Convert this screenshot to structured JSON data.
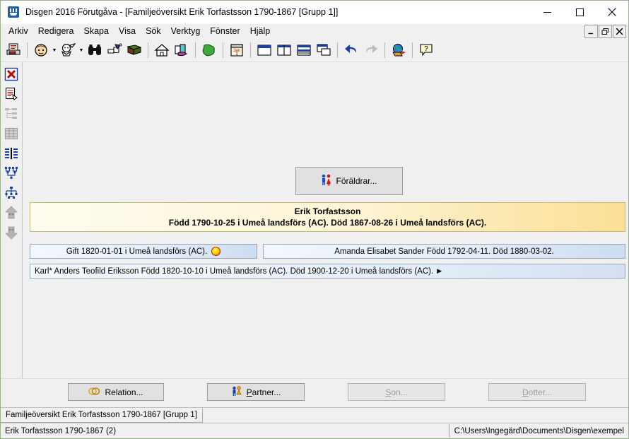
{
  "window": {
    "title": "Disgen 2016 Förutgåva - [Familjeöversikt Erik Torfastsson 1790-1867 [Grupp 1]]",
    "app_icon": "disgen-app-icon",
    "minimize": "minimize-icon",
    "maximize": "maximize-icon",
    "close": "close-icon"
  },
  "menubar": {
    "items": [
      {
        "label": "Arkiv"
      },
      {
        "label": "Redigera"
      },
      {
        "label": "Skapa"
      },
      {
        "label": "Visa"
      },
      {
        "label": "Sök"
      },
      {
        "label": "Verktyg"
      },
      {
        "label": "Fönster"
      },
      {
        "label": "Hjälp"
      }
    ],
    "mdi": {
      "minimize": "mdi-minimize-icon",
      "restore": "mdi-restore-icon",
      "close": "mdi-close-icon"
    }
  },
  "toolbar": {
    "buttons": [
      {
        "name": "print-icon"
      },
      {
        "name": "person-face-icon"
      },
      {
        "name": "person-search-icon"
      },
      {
        "name": "binoculars-icon"
      },
      {
        "name": "hand-pointer-icon"
      },
      {
        "name": "book-icon"
      },
      {
        "name": "home-icon"
      },
      {
        "name": "places-icon"
      },
      {
        "name": "map-icon"
      },
      {
        "name": "calendar-icon"
      },
      {
        "name": "window-cascade-icon"
      },
      {
        "name": "window-vertical-tile-icon"
      },
      {
        "name": "window-horizontal-tile-icon"
      },
      {
        "name": "window-arrange-icon"
      },
      {
        "name": "undo-icon"
      },
      {
        "name": "redo-icon"
      },
      {
        "name": "internet-icon"
      },
      {
        "name": "help-icon"
      }
    ]
  },
  "sidebar": {
    "buttons": [
      {
        "name": "close-view-icon"
      },
      {
        "name": "notes-icon"
      },
      {
        "name": "tree-list-icon"
      },
      {
        "name": "table-view-icon"
      },
      {
        "name": "family-overview-icon"
      },
      {
        "name": "ancestor-chart-icon"
      },
      {
        "name": "descendant-chart-icon"
      },
      {
        "name": "ancestors-up-icon"
      },
      {
        "name": "descendants-down-icon"
      }
    ]
  },
  "main": {
    "parents_button": "Föräldrar...",
    "parents_icon": "parents-couple-icon",
    "person": {
      "name": "Erik Torfastsson",
      "details": "Född 1790-10-25 i Umeå landsförs (AC). Död 1867-08-26 i Umeå landsförs (AC)."
    },
    "relation_row": {
      "text": "Gift 1820-01-01 i Umeå landsförs (AC).",
      "marker": "relation-marker-icon"
    },
    "partner_row": {
      "text": "Amanda Elisabet Sander Född 1792-04-11. Död 1880-03-02."
    },
    "child_row": {
      "text": "Karl* Anders Teofild Eriksson Född 1820-10-10 i Umeå landsförs (AC). Död 1900-12-20 i Umeå landsförs (AC).",
      "expander": "▶"
    }
  },
  "bottom_buttons": [
    {
      "label": "Relation...",
      "icon": "rings-icon",
      "enabled": true
    },
    {
      "label": "Partner...",
      "icon": "partner-couple-icon",
      "enabled": true,
      "accesskey": "P"
    },
    {
      "label": "Son...",
      "icon": "",
      "enabled": false,
      "accesskey": "S"
    },
    {
      "label": "Dotter...",
      "icon": "",
      "enabled": false,
      "accesskey": "D"
    }
  ],
  "status": {
    "tab": "Familjeöversikt Erik Torfastsson 1790-1867 [Grupp 1]",
    "left": "Erik Torfastsson 1790-1867 (2)",
    "right": "C:\\Users\\Ingegärd\\Documents\\Disgen\\exempel"
  },
  "colors": {
    "person_band_border": "#c9b77e",
    "person_band_bg": "#fdf4d4",
    "row_border": "#9aa7bb",
    "row_bg": "#e3edf9",
    "marker": "#ffd400",
    "window_bg": "#f0f0f0"
  }
}
